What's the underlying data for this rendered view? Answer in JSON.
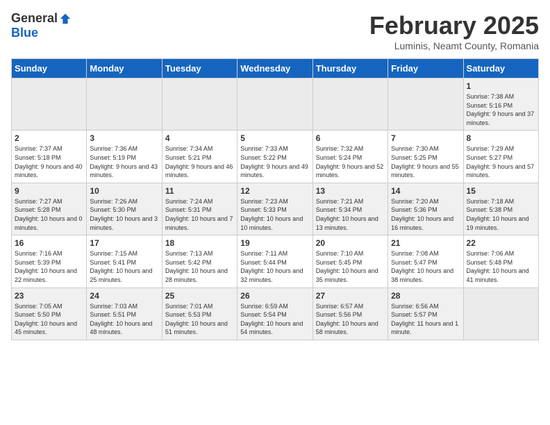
{
  "header": {
    "logo_general": "General",
    "logo_blue": "Blue",
    "month_title": "February 2025",
    "subtitle": "Luminis, Neamt County, Romania"
  },
  "weekdays": [
    "Sunday",
    "Monday",
    "Tuesday",
    "Wednesday",
    "Thursday",
    "Friday",
    "Saturday"
  ],
  "weeks": [
    [
      {
        "day": "",
        "info": ""
      },
      {
        "day": "",
        "info": ""
      },
      {
        "day": "",
        "info": ""
      },
      {
        "day": "",
        "info": ""
      },
      {
        "day": "",
        "info": ""
      },
      {
        "day": "",
        "info": ""
      },
      {
        "day": "1",
        "info": "Sunrise: 7:38 AM\nSunset: 5:16 PM\nDaylight: 9 hours and 37 minutes."
      }
    ],
    [
      {
        "day": "2",
        "info": "Sunrise: 7:37 AM\nSunset: 5:18 PM\nDaylight: 9 hours and 40 minutes."
      },
      {
        "day": "3",
        "info": "Sunrise: 7:36 AM\nSunset: 5:19 PM\nDaylight: 9 hours and 43 minutes."
      },
      {
        "day": "4",
        "info": "Sunrise: 7:34 AM\nSunset: 5:21 PM\nDaylight: 9 hours and 46 minutes."
      },
      {
        "day": "5",
        "info": "Sunrise: 7:33 AM\nSunset: 5:22 PM\nDaylight: 9 hours and 49 minutes."
      },
      {
        "day": "6",
        "info": "Sunrise: 7:32 AM\nSunset: 5:24 PM\nDaylight: 9 hours and 52 minutes."
      },
      {
        "day": "7",
        "info": "Sunrise: 7:30 AM\nSunset: 5:25 PM\nDaylight: 9 hours and 55 minutes."
      },
      {
        "day": "8",
        "info": "Sunrise: 7:29 AM\nSunset: 5:27 PM\nDaylight: 9 hours and 57 minutes."
      }
    ],
    [
      {
        "day": "9",
        "info": "Sunrise: 7:27 AM\nSunset: 5:28 PM\nDaylight: 10 hours and 0 minutes."
      },
      {
        "day": "10",
        "info": "Sunrise: 7:26 AM\nSunset: 5:30 PM\nDaylight: 10 hours and 3 minutes."
      },
      {
        "day": "11",
        "info": "Sunrise: 7:24 AM\nSunset: 5:31 PM\nDaylight: 10 hours and 7 minutes."
      },
      {
        "day": "12",
        "info": "Sunrise: 7:23 AM\nSunset: 5:33 PM\nDaylight: 10 hours and 10 minutes."
      },
      {
        "day": "13",
        "info": "Sunrise: 7:21 AM\nSunset: 5:34 PM\nDaylight: 10 hours and 13 minutes."
      },
      {
        "day": "14",
        "info": "Sunrise: 7:20 AM\nSunset: 5:36 PM\nDaylight: 10 hours and 16 minutes."
      },
      {
        "day": "15",
        "info": "Sunrise: 7:18 AM\nSunset: 5:38 PM\nDaylight: 10 hours and 19 minutes."
      }
    ],
    [
      {
        "day": "16",
        "info": "Sunrise: 7:16 AM\nSunset: 5:39 PM\nDaylight: 10 hours and 22 minutes."
      },
      {
        "day": "17",
        "info": "Sunrise: 7:15 AM\nSunset: 5:41 PM\nDaylight: 10 hours and 25 minutes."
      },
      {
        "day": "18",
        "info": "Sunrise: 7:13 AM\nSunset: 5:42 PM\nDaylight: 10 hours and 28 minutes."
      },
      {
        "day": "19",
        "info": "Sunrise: 7:11 AM\nSunset: 5:44 PM\nDaylight: 10 hours and 32 minutes."
      },
      {
        "day": "20",
        "info": "Sunrise: 7:10 AM\nSunset: 5:45 PM\nDaylight: 10 hours and 35 minutes."
      },
      {
        "day": "21",
        "info": "Sunrise: 7:08 AM\nSunset: 5:47 PM\nDaylight: 10 hours and 38 minutes."
      },
      {
        "day": "22",
        "info": "Sunrise: 7:06 AM\nSunset: 5:48 PM\nDaylight: 10 hours and 41 minutes."
      }
    ],
    [
      {
        "day": "23",
        "info": "Sunrise: 7:05 AM\nSunset: 5:50 PM\nDaylight: 10 hours and 45 minutes."
      },
      {
        "day": "24",
        "info": "Sunrise: 7:03 AM\nSunset: 5:51 PM\nDaylight: 10 hours and 48 minutes."
      },
      {
        "day": "25",
        "info": "Sunrise: 7:01 AM\nSunset: 5:53 PM\nDaylight: 10 hours and 51 minutes."
      },
      {
        "day": "26",
        "info": "Sunrise: 6:59 AM\nSunset: 5:54 PM\nDaylight: 10 hours and 54 minutes."
      },
      {
        "day": "27",
        "info": "Sunrise: 6:57 AM\nSunset: 5:56 PM\nDaylight: 10 hours and 58 minutes."
      },
      {
        "day": "28",
        "info": "Sunrise: 6:56 AM\nSunset: 5:57 PM\nDaylight: 11 hours and 1 minute."
      },
      {
        "day": "",
        "info": ""
      }
    ]
  ]
}
